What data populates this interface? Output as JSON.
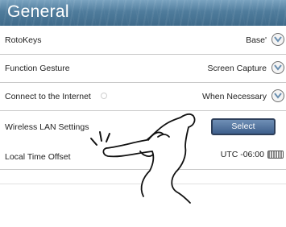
{
  "header": {
    "title": "General"
  },
  "settings": [
    {
      "label": "RotoKeys",
      "value": "Base'"
    },
    {
      "label": "Function Gesture",
      "value": "Screen Capture"
    },
    {
      "label": "Connect to the Internet",
      "value": "When Necessary"
    },
    {
      "label": "Wireless LAN Settings",
      "button": "Select"
    },
    {
      "label": "Local Time Offset",
      "value": "UTC -06:00"
    }
  ],
  "icons": {
    "spin": "chevron-down-circle-icon",
    "keyboard": "keyboard-icon",
    "gesture": "pointing-hand-icon"
  },
  "colors": {
    "header": "#4f7c9c",
    "button": "#3e5f8c"
  }
}
